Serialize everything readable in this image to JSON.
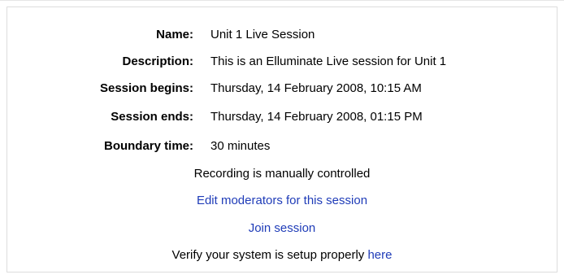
{
  "session": {
    "fields": [
      {
        "label": "Name:",
        "value": "Unit 1 Live Session"
      },
      {
        "label": "Description:",
        "value": "This is an Elluminate Live session for Unit 1"
      },
      {
        "label": "Session begins:",
        "value": "Thursday, 14 February 2008, 10:15 AM"
      },
      {
        "label": "Session ends:",
        "value": "Thursday, 14 February 2008, 01:15 PM"
      },
      {
        "label": "Boundary time:",
        "value": "30 minutes"
      }
    ],
    "recording_text": "Recording is manually controlled",
    "edit_moderators_link": "Edit moderators for this session",
    "join_link": "Join session",
    "verify_text": "Verify your system is setup properly",
    "verify_link": "here"
  },
  "colors": {
    "link": "#1f3cb8",
    "border": "#dddddd"
  }
}
